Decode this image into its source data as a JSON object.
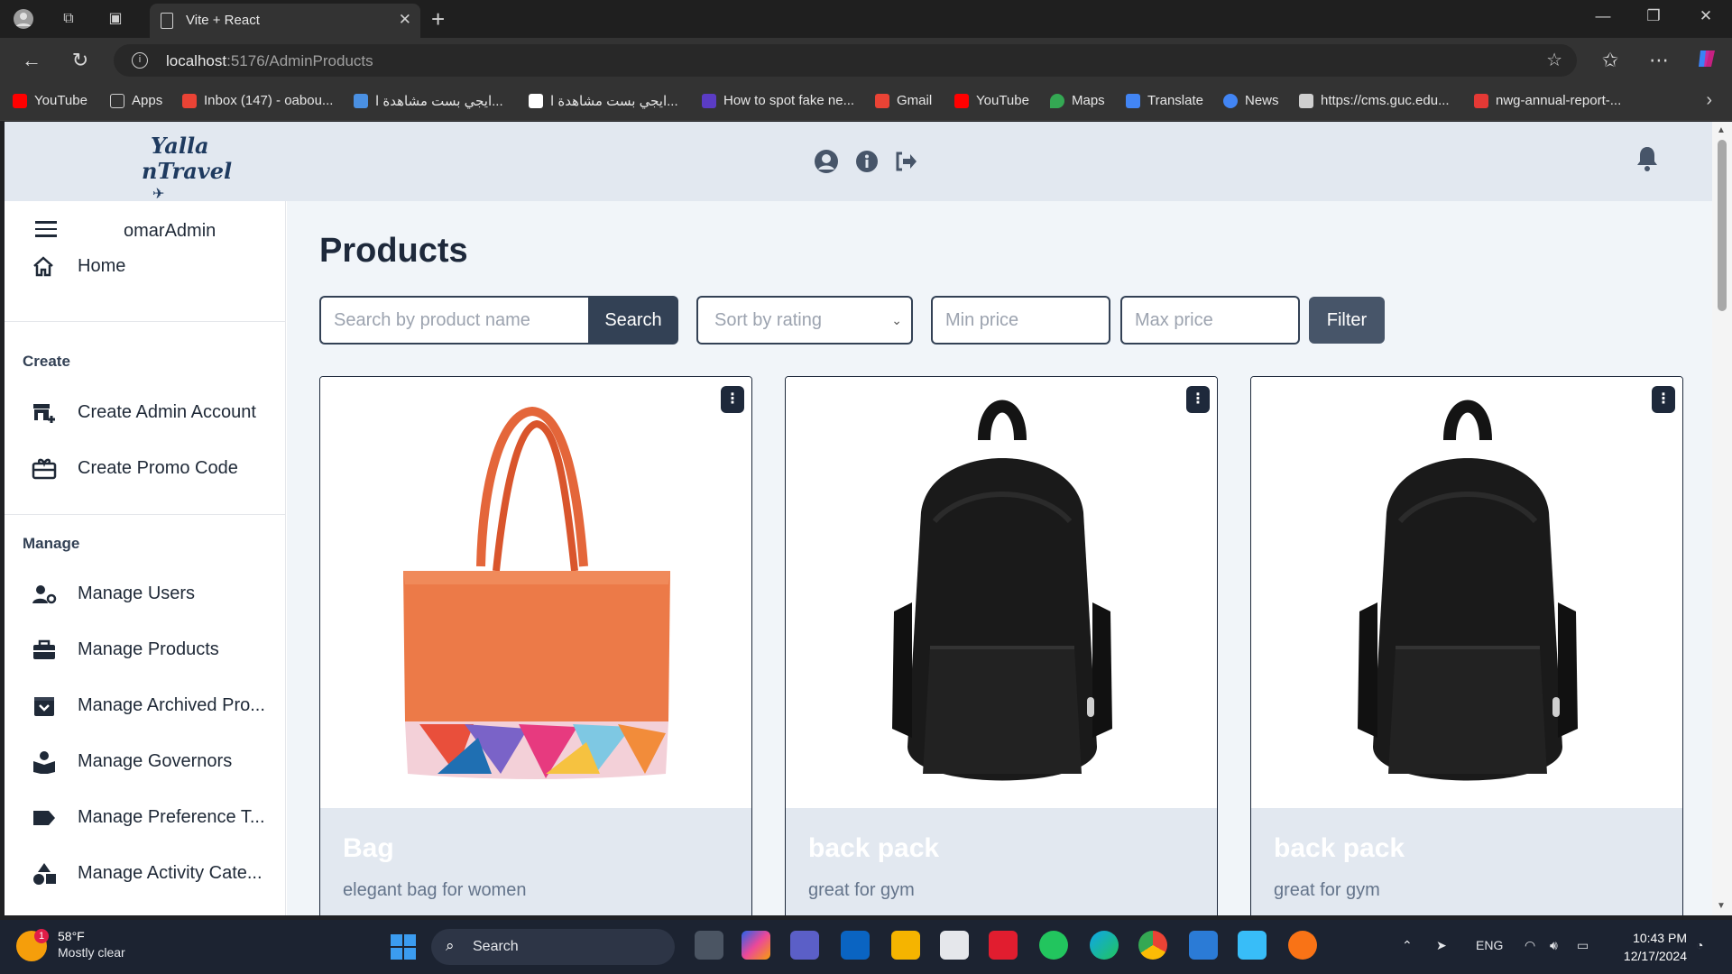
{
  "browser": {
    "tab_title": "Vite + React",
    "url_host": "localhost",
    "url_path": ":5176/AdminProducts",
    "bookmarks": [
      {
        "label": "YouTube",
        "color": "#ff0000"
      },
      {
        "label": "Apps",
        "color": "#9aa0a6"
      },
      {
        "label": "Inbox (147) - oabou...",
        "color": "#ea4335"
      },
      {
        "label": "ايجي بست مشاهدة ا...",
        "color": "#4a90e2"
      },
      {
        "label": "ايجي بست مشاهدة ا...",
        "color": "#ffffff"
      },
      {
        "label": "How to spot fake ne...",
        "color": "#5b3cc4"
      },
      {
        "label": "Gmail",
        "color": "#ea4335"
      },
      {
        "label": "YouTube",
        "color": "#ff0000"
      },
      {
        "label": "Maps",
        "color": "#34a853"
      },
      {
        "label": "Translate",
        "color": "#4285f4"
      },
      {
        "label": "News",
        "color": "#4285f4"
      },
      {
        "label": "https://cms.guc.edu...",
        "color": "#cfcfcf"
      },
      {
        "label": "nwg-annual-report-...",
        "color": "#e53935"
      }
    ]
  },
  "app": {
    "logo_line1": "Yalla",
    "logo_line2": "nTravel",
    "admin_name": "omarAdmin",
    "sidebar": {
      "home": "Home",
      "create_heading": "Create",
      "create_items": [
        "Create Admin Account",
        "Create Promo Code"
      ],
      "manage_heading": "Manage",
      "manage_items": [
        "Manage Users",
        "Manage Products",
        "Manage Archived Pro...",
        "Manage Governors",
        "Manage Preference T...",
        "Manage Activity Cate..."
      ]
    },
    "page_title": "Products",
    "search": {
      "placeholder": "Search by product name",
      "button": "Search"
    },
    "sort": {
      "selected": "Sort by rating"
    },
    "min_price": {
      "placeholder": "Min price"
    },
    "max_price": {
      "placeholder": "Max price"
    },
    "filter_button": "Filter",
    "products": [
      {
        "name": "Bag",
        "description": "elegant bag for women",
        "image": "orange-tote-bag"
      },
      {
        "name": "back pack",
        "description": "great for gym",
        "image": "black-backpack"
      },
      {
        "name": "back pack",
        "description": "great for gym",
        "image": "black-backpack"
      }
    ]
  },
  "taskbar": {
    "weather_temp": "58°F",
    "weather_cond": "Mostly clear",
    "weather_badge": "1",
    "search_label": "Search",
    "lang": "ENG",
    "time": "10:43 PM",
    "date": "12/17/2024"
  }
}
